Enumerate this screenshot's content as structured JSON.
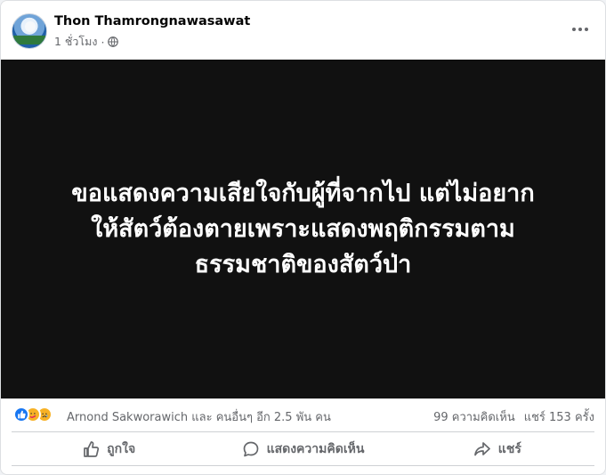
{
  "post": {
    "author": "Thon Thamrongnawasawat",
    "time": "1 ชั่วโมง",
    "separator": "·",
    "privacy_icon": "globe-icon",
    "more_icon": "more-horizontal-icon"
  },
  "media": {
    "lines": [
      "ขอแสดงความเสียใจกับผู้ที่จากไป แต่ไม่อยาก",
      "ให้สัตว์ต้องตายเพราะแสดงพฤติกรรมตาม",
      "ธรรมชาติของสัตว์ป่า"
    ]
  },
  "stats": {
    "reaction_icons": [
      "like-icon",
      "care-icon",
      "sad-icon"
    ],
    "reaction_text": "Arnond Sakworawich และ คนอื่นๆ อีก 2.5 พัน คน",
    "comments": "99 ความคิดเห็น",
    "shares": "แชร์ 153 ครั้ง"
  },
  "actions": {
    "like": "ถูกใจ",
    "comment": "แสดงความคิดเห็น",
    "share": "แชร์"
  },
  "colors": {
    "like_blue": "#1877f2",
    "reaction_yellow": "#f7b125",
    "muted_text": "#65676b",
    "media_bg": "#111111"
  }
}
